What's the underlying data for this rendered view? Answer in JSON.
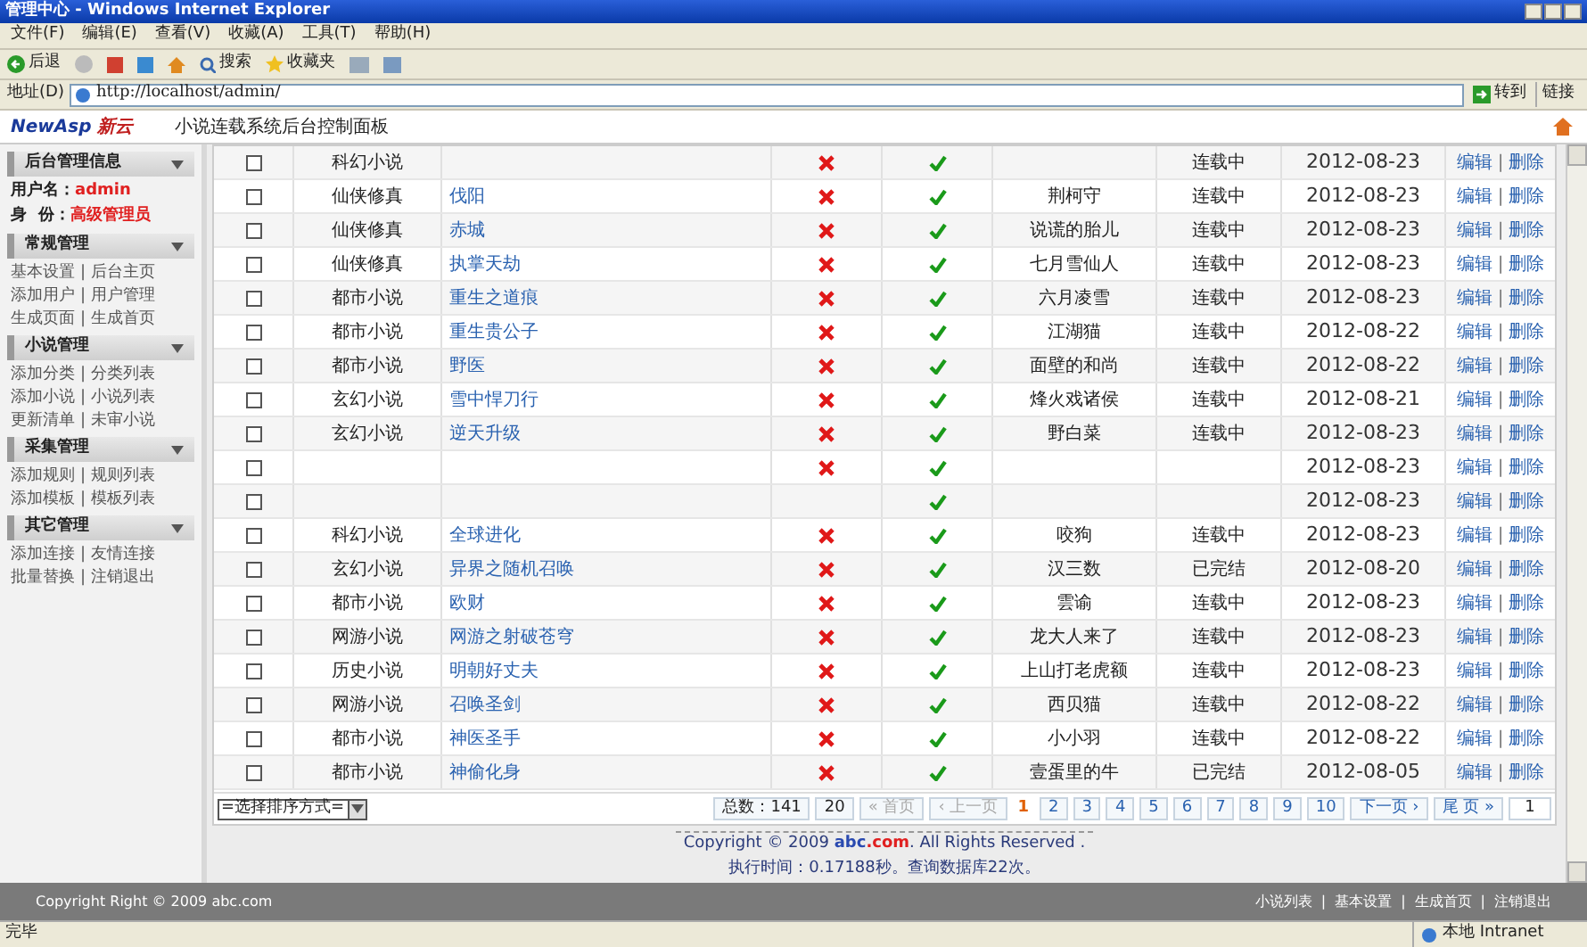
{
  "browser": {
    "title": "管理中心 - Windows Internet Explorer",
    "menu": [
      "文件(F)",
      "编辑(E)",
      "查看(V)",
      "收藏(A)",
      "工具(T)",
      "帮助(H)"
    ],
    "toolbar": [
      "后退",
      "搜索",
      "收藏夹"
    ],
    "address_label": "地址(D)",
    "url": "http://localhost/admin/",
    "go": "转到",
    "links": "链接"
  },
  "app_header": {
    "logo_latin": "NewAsp",
    "logo_cn": "新云",
    "title": "小说连载系统后台控制面板"
  },
  "sidebar": [
    {
      "title": "后台管理信息",
      "kind": "info",
      "items": [
        {
          "label": "用户名：",
          "value": "admin"
        },
        {
          "label": "身  份：",
          "value": "高级管理员"
        }
      ]
    },
    {
      "title": "常规管理",
      "kind": "links",
      "items": [
        [
          "基本设置",
          "|",
          "后台主页"
        ],
        [
          "添加用户",
          "|",
          "用户管理"
        ],
        [
          "生成页面",
          "|",
          "生成首页"
        ]
      ]
    },
    {
      "title": "小说管理",
      "kind": "links",
      "items": [
        [
          "添加分类",
          "|",
          "分类列表"
        ],
        [
          "添加小说",
          "|",
          "小说列表"
        ],
        [
          "更新清单",
          "|",
          "未审小说"
        ]
      ]
    },
    {
      "title": "采集管理",
      "kind": "links",
      "items": [
        [
          "添加规则",
          "|",
          "规则列表"
        ],
        [
          "添加模板",
          "|",
          "模板列表"
        ]
      ]
    },
    {
      "title": "其它管理",
      "kind": "links",
      "items": [
        [
          "添加连接",
          "|",
          "友情连接"
        ],
        [
          "批量替换",
          "|",
          "注销退出"
        ]
      ]
    }
  ],
  "table": {
    "rows": [
      {
        "checked": false,
        "category": "科幻小说",
        "state_1": false,
        "state_2": true,
        "status": "连载中",
        "date": "2012-08-23",
        "edit": "编辑",
        "separator": "|",
        "delete": "删除"
      },
      {
        "checked": false,
        "category": "仙侠修真",
        "title": "伐阳",
        "state_1": false,
        "state_2": true,
        "author": "荆柯守",
        "status": "连载中",
        "date": "2012-08-23",
        "edit": "编辑",
        "separator": "|",
        "delete": "删除"
      },
      {
        "checked": false,
        "category": "仙侠修真",
        "title": "赤城",
        "state_1": false,
        "state_2": true,
        "author": "说谎的胎儿",
        "status": "连载中",
        "date": "2012-08-23",
        "edit": "编辑",
        "separator": "|",
        "delete": "删除"
      },
      {
        "checked": false,
        "category": "仙侠修真",
        "title": "执掌天劫",
        "state_1": false,
        "state_2": true,
        "author": "七月雪仙人",
        "status": "连载中",
        "date": "2012-08-23",
        "edit": "编辑",
        "separator": "|",
        "delete": "删除"
      },
      {
        "checked": false,
        "category": "都市小说",
        "title": "重生之道痕",
        "state_1": false,
        "state_2": true,
        "author": "六月凌雪",
        "status": "连载中",
        "date": "2012-08-23",
        "edit": "编辑",
        "separator": "|",
        "delete": "删除"
      },
      {
        "checked": false,
        "category": "都市小说",
        "title": "重生贵公子",
        "state_1": false,
        "state_2": true,
        "author": "江湖猫",
        "status": "连载中",
        "date": "2012-08-22",
        "edit": "编辑",
        "separator": "|",
        "delete": "删除"
      },
      {
        "checked": false,
        "category": "都市小说",
        "title": "野医",
        "state_1": false,
        "state_2": true,
        "author": "面壁的和尚",
        "status": "连载中",
        "date": "2012-08-22",
        "edit": "编辑",
        "separator": "|",
        "delete": "删除"
      },
      {
        "checked": false,
        "category": "玄幻小说",
        "title": "雪中悍刀行",
        "state_1": false,
        "state_2": true,
        "author": "烽火戏诸侯",
        "status": "连载中",
        "date": "2012-08-21",
        "edit": "编辑",
        "separator": "|",
        "delete": "删除"
      },
      {
        "checked": false,
        "category": "玄幻小说",
        "title": "逆天升级",
        "state_1": false,
        "state_2": true,
        "author": "野白菜",
        "status": "连载中",
        "date": "2012-08-23",
        "edit": "编辑",
        "separator": "|",
        "delete": "删除"
      },
      {
        "checked": false,
        "state_1": false,
        "state_2": true,
        "date": "2012-08-23",
        "edit": "编辑",
        "separator": "|",
        "delete": "删除"
      },
      {
        "checked": false,
        "state_2": true,
        "date": "2012-08-23",
        "edit": "编辑",
        "separator": "|",
        "delete": "删除"
      },
      {
        "checked": false,
        "category": "科幻小说",
        "title": "全球进化",
        "state_1": false,
        "state_2": true,
        "author": "咬狗",
        "status": "连载中",
        "date": "2012-08-23",
        "edit": "编辑",
        "separator": "|",
        "delete": "删除"
      },
      {
        "checked": false,
        "category": "玄幻小说",
        "title": "异界之随机召唤",
        "state_1": false,
        "state_2": true,
        "author": "汉三数",
        "status": "已完结",
        "date": "2012-08-20",
        "edit": "编辑",
        "separator": "|",
        "delete": "删除"
      },
      {
        "checked": false,
        "category": "都市小说",
        "title": "欧财",
        "state_1": false,
        "state_2": true,
        "author": "雲谕",
        "status": "连载中",
        "date": "2012-08-23",
        "edit": "编辑",
        "separator": "|",
        "delete": "删除"
      },
      {
        "checked": false,
        "category": "网游小说",
        "title": "网游之射破苍穹",
        "state_1": false,
        "state_2": true,
        "author": "龙大人来了",
        "status": "连载中",
        "date": "2012-08-23",
        "edit": "编辑",
        "separator": "|",
        "delete": "删除"
      },
      {
        "checked": false,
        "category": "历史小说",
        "title": "明朝好丈夫",
        "state_1": false,
        "state_2": true,
        "author": "上山打老虎额",
        "status": "连载中",
        "date": "2012-08-23",
        "edit": "编辑",
        "separator": "|",
        "delete": "删除"
      },
      {
        "checked": false,
        "category": "网游小说",
        "title": "召唤圣剑",
        "state_1": false,
        "state_2": true,
        "author": "西贝猫",
        "status": "连载中",
        "date": "2012-08-22",
        "edit": "编辑",
        "separator": "|",
        "delete": "删除"
      },
      {
        "checked": false,
        "category": "都市小说",
        "title": "神医圣手",
        "state_1": false,
        "state_2": true,
        "author": "小小羽",
        "status": "连载中",
        "date": "2012-08-22",
        "edit": "编辑",
        "separator": "|",
        "delete": "删除"
      },
      {
        "checked": false,
        "category": "都市小说",
        "title": "神偷化身",
        "state_1": false,
        "state_2": true,
        "author": "壹蛋里的牛",
        "status": "已完结",
        "date": "2012-08-05",
        "edit": "编辑",
        "separator": "|",
        "delete": "删除"
      }
    ]
  },
  "pagination": {
    "sort_select": "=选择排序方式=",
    "total": "总数：141",
    "per_page": "20",
    "first": "« 首页",
    "prev": "‹ 上一页",
    "pages": [
      {
        "label": "1",
        "selected": true
      },
      {
        "label": "2",
        "selected": false
      },
      {
        "label": "3",
        "selected": false
      },
      {
        "label": "4",
        "selected": false
      },
      {
        "label": "5",
        "selected": false
      },
      {
        "label": "6",
        "selected": false
      },
      {
        "label": "7",
        "selected": false
      },
      {
        "label": "8",
        "selected": false
      },
      {
        "label": "9",
        "selected": false
      },
      {
        "label": "10",
        "selected": false
      }
    ],
    "next": "下一页 ›",
    "last": "尾 页 »",
    "jump_value": "1"
  },
  "footer": {
    "copyright_before": "Copyright © 2009 ",
    "site_name": "abc",
    "site_tld": ".com",
    "copyright_after": ". All Rights Reserved .",
    "timing": "执行时间：0.17188秒。查询数据库22次。"
  },
  "bottom_bar": {
    "copyright": "Copyright Right © 2009 abc.com",
    "links": [
      "小说列表",
      "|",
      "基本设置",
      "|",
      "生成首页",
      "|",
      "注销退出"
    ]
  },
  "status_bar": {
    "text": "完毕",
    "zone": "本地 Intranet"
  }
}
